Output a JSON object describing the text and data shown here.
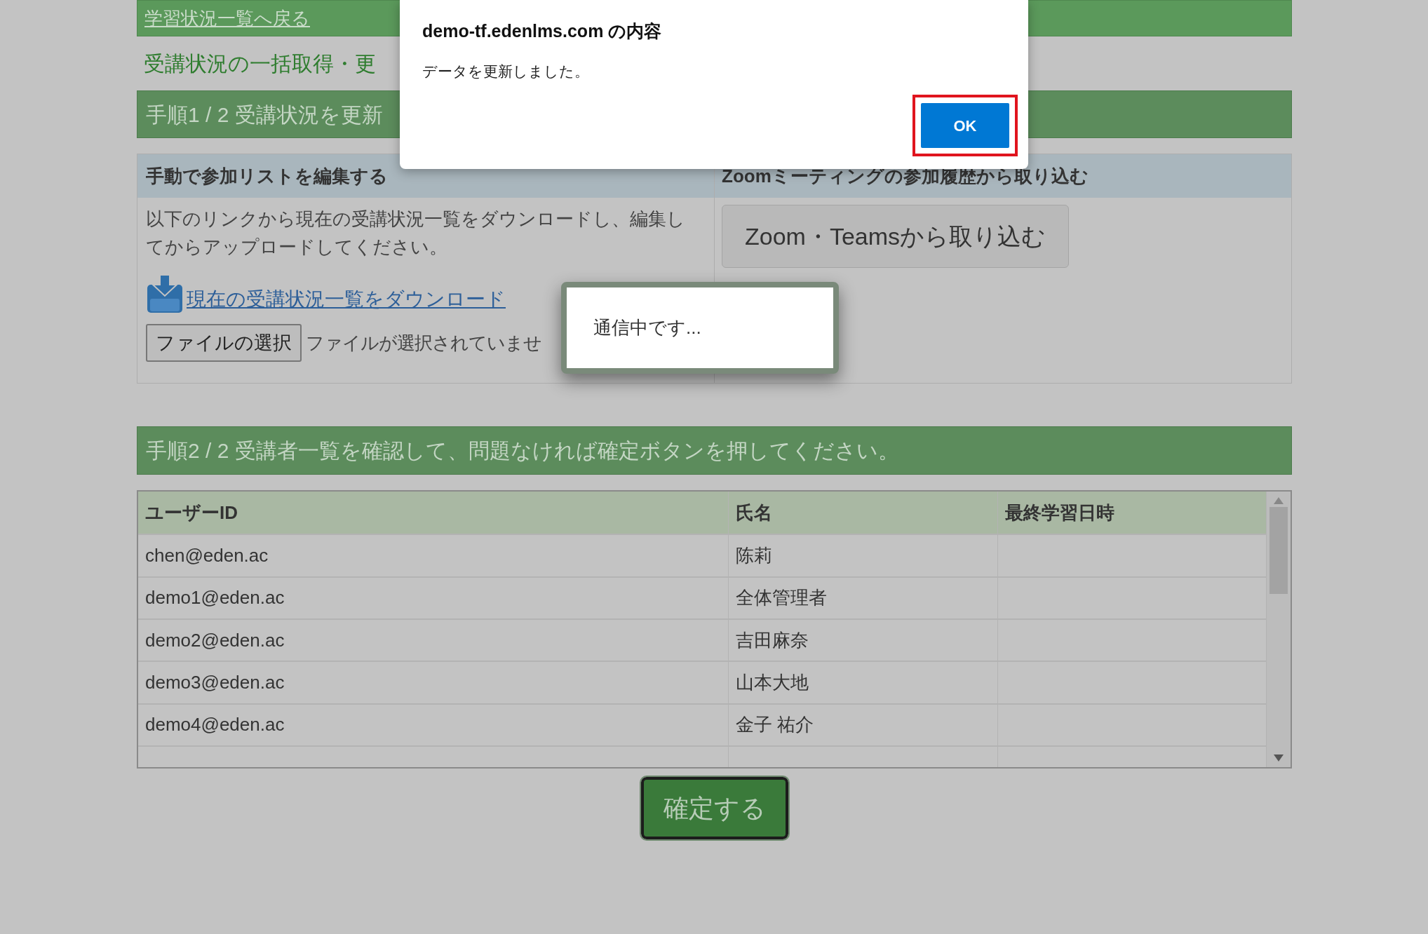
{
  "back_link": "学習状況一覧へ戻る",
  "page_title": "受講状況の一括取得・更",
  "step1": {
    "header": "手順1 / 2 受講状況を更新",
    "manual": {
      "title": "手動で参加リストを編集する",
      "description": "以下のリンクから現在の受講状況一覧をダウンロードし、編集してからアップロードしてください。",
      "download_link": "現在の受講状況一覧をダウンロード",
      "file_button": "ファイルの選択",
      "file_status": "ファイルが選択されていませ"
    },
    "zoom": {
      "title": "Zoomミーティングの参加履歴から取り込む",
      "button": "Zoom・Teamsから取り込む"
    }
  },
  "step2": {
    "header": "手順2 / 2 受講者一覧を確認して、問題なければ確定ボタンを押してください。",
    "table": {
      "columns": [
        "ユーザーID",
        "氏名",
        "最終学習日時"
      ],
      "rows": [
        {
          "user_id": "chen@eden.ac",
          "name": "陈莉"
        },
        {
          "user_id": "demo1@eden.ac",
          "name": "全体管理者"
        },
        {
          "user_id": "demo2@eden.ac",
          "name": "吉田麻奈"
        },
        {
          "user_id": "demo3@eden.ac",
          "name": "山本大地"
        },
        {
          "user_id": "demo4@eden.ac",
          "name": "金子 祐介"
        }
      ]
    }
  },
  "confirm_button": "確定する",
  "alert": {
    "title": "demo-tf.edenlms.com の内容",
    "message": "データを更新しました。",
    "ok_button": "OK"
  },
  "loading": {
    "message": "通信中です..."
  }
}
